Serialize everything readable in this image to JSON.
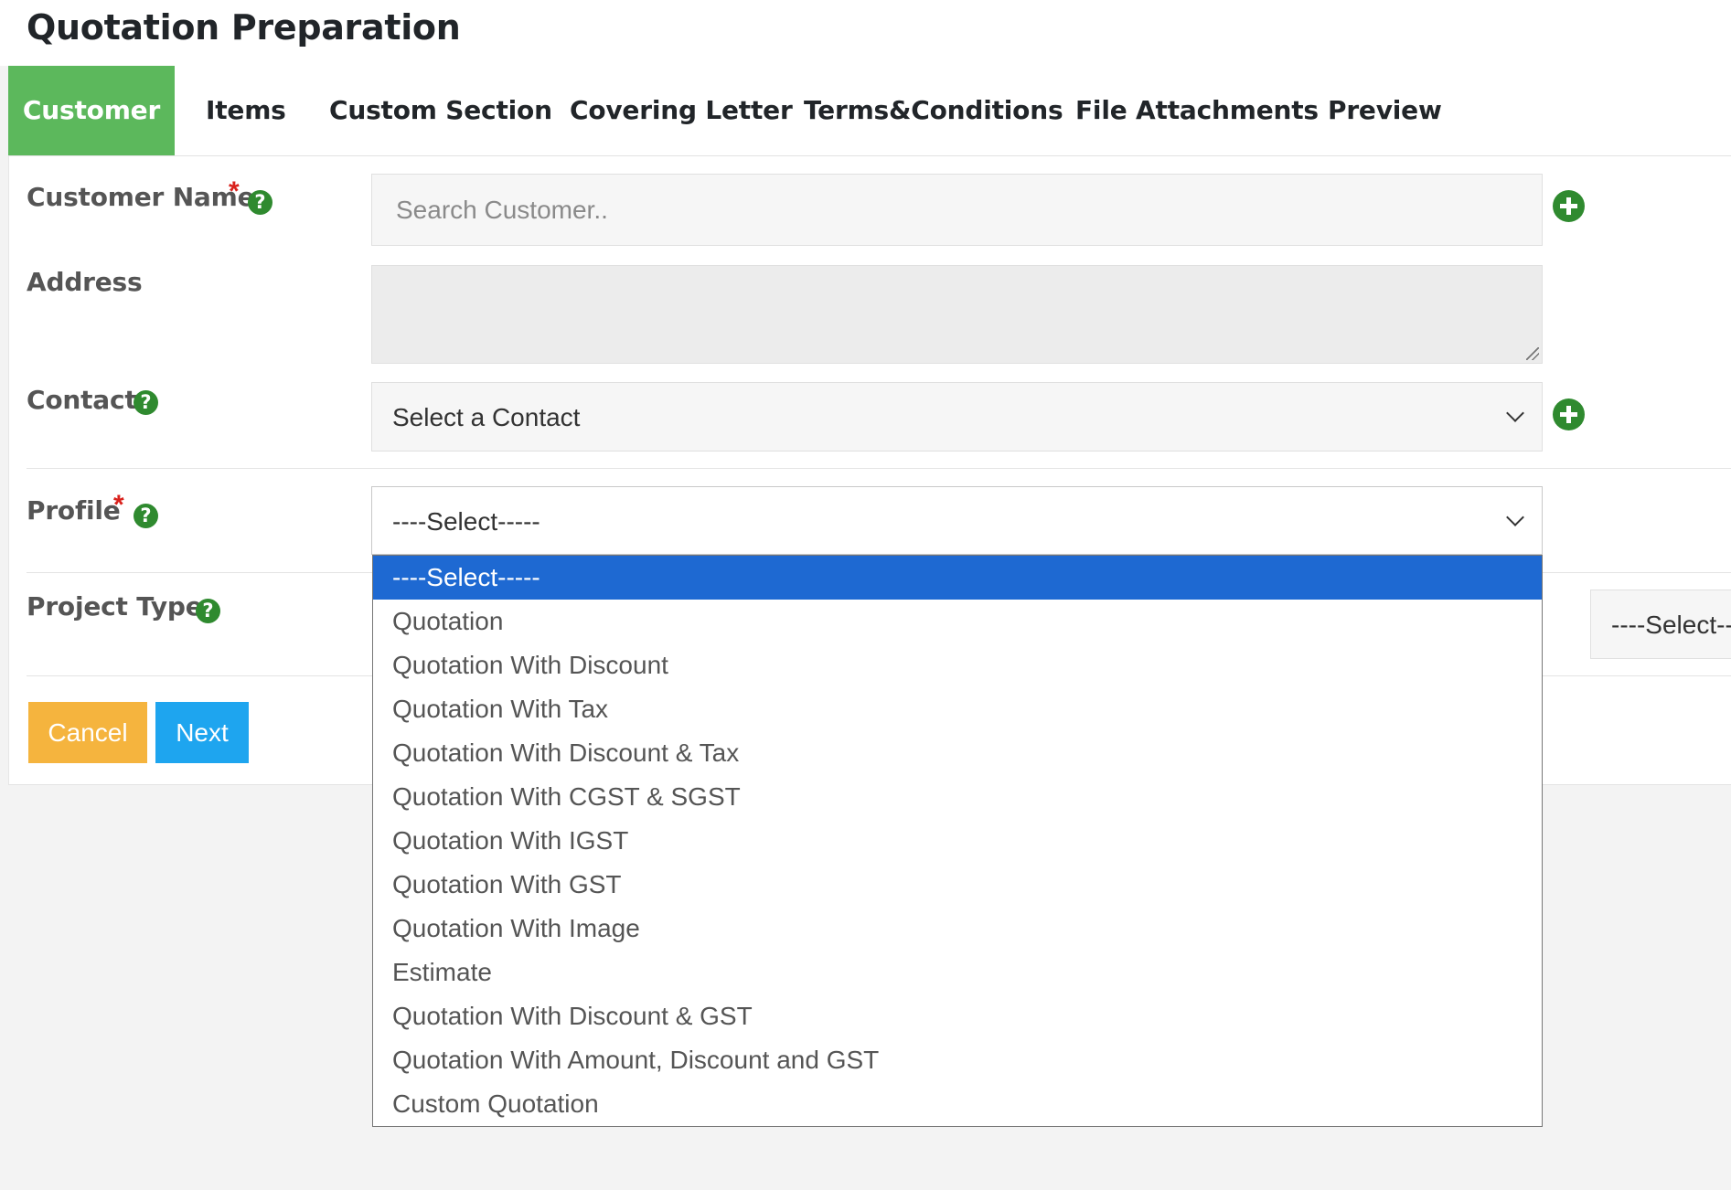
{
  "page": {
    "title": "Quotation Preparation"
  },
  "tabs": [
    {
      "label": "Customer",
      "active": true
    },
    {
      "label": "Items"
    },
    {
      "label": "Custom Section"
    },
    {
      "label": "Covering Letter"
    },
    {
      "label": "Terms&Conditions"
    },
    {
      "label": "File Attachments"
    },
    {
      "label": "Preview"
    }
  ],
  "form": {
    "customer_name": {
      "label": "Customer Name",
      "required_mark": "*",
      "help_glyph": "?",
      "placeholder": "Search Customer..",
      "value": ""
    },
    "address": {
      "label": "Address",
      "value": ""
    },
    "contact": {
      "label": "Contact",
      "help_glyph": "?",
      "selected": "Select a Contact"
    },
    "profile": {
      "label": "Profile",
      "required_mark": "*",
      "help_glyph": "?",
      "selected": "----Select-----",
      "options": [
        "----Select-----",
        "Quotation",
        "Quotation With Discount",
        "Quotation With Tax",
        "Quotation With Discount & Tax",
        "Quotation With CGST & SGST",
        "Quotation With IGST",
        "Quotation With GST",
        "Quotation With Image",
        "Estimate",
        "Quotation With Discount & GST",
        "Quotation With Amount, Discount and GST",
        "Custom Quotation"
      ]
    },
    "project_type": {
      "label": "Project Type",
      "help_glyph": "?",
      "selected": "----Select--"
    }
  },
  "buttons": {
    "cancel": "Cancel",
    "next": "Next"
  },
  "icons": {
    "help": "question-circle-icon",
    "add": "plus-circle-icon",
    "dropdown": "chevron-down-icon"
  },
  "colors": {
    "active_tab": "#5cb85c",
    "help_icon": "#2f8a2f",
    "required": "#d9211c",
    "cancel_button": "#f5b43e",
    "next_button": "#1ea5ef",
    "option_highlight": "#1e69d2"
  }
}
